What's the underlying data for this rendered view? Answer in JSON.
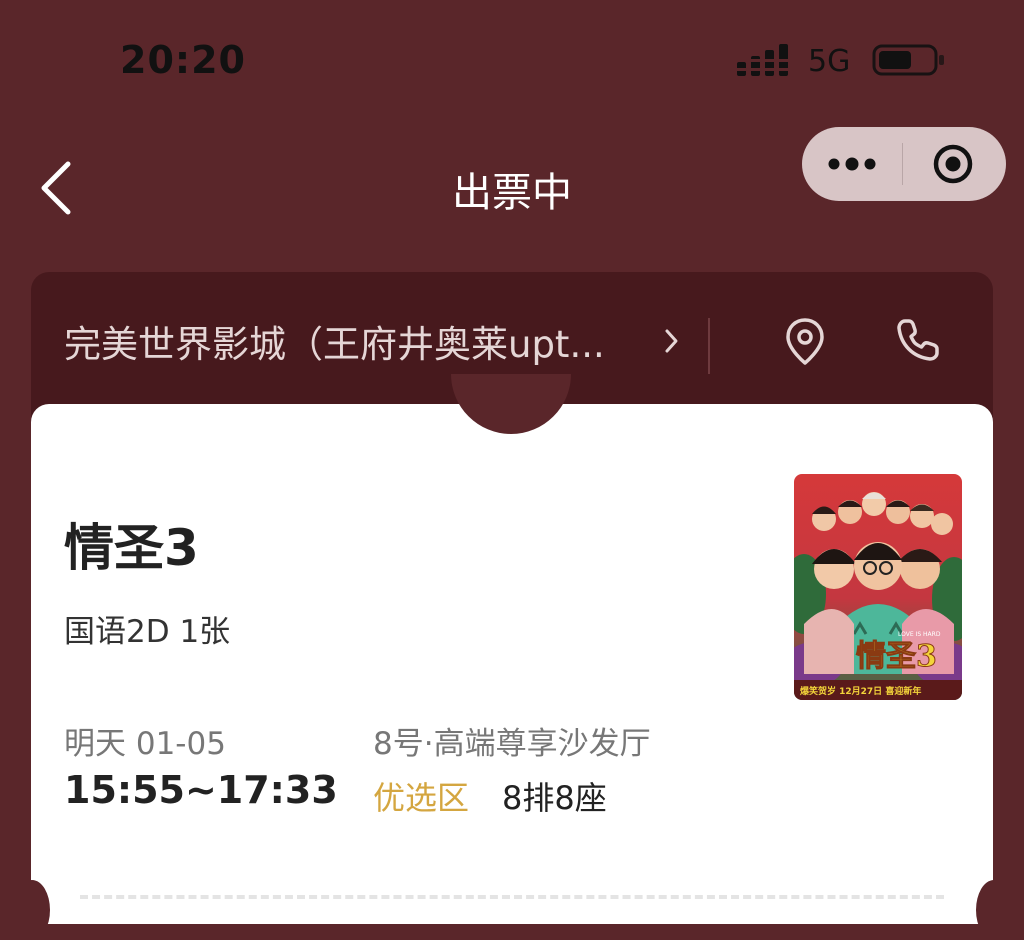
{
  "status_bar": {
    "time": "20:20",
    "network": "5G"
  },
  "nav": {
    "title": "出票中"
  },
  "cinema": {
    "name": "完美世界影城（王府井奥莱upt..."
  },
  "movie": {
    "title": "情圣3",
    "format": "国语2D 1张",
    "date": "明天 01-05",
    "time_range": "15:55~17:33",
    "hall": "8号·高端尊享沙发厅",
    "zone": "优选区",
    "seat": "8排8座",
    "poster": {
      "title_text": "情圣3",
      "release_text": "爆笑贺岁 12月27日 喜迎新年",
      "tagline": "LOVE IS HARD"
    }
  },
  "colors": {
    "background": "#5a262a",
    "cinema_bar": "#47191d",
    "zone_accent": "#d4a640"
  },
  "icons": [
    "signal-icon",
    "battery-icon",
    "back-icon",
    "more-icon",
    "close-target-icon",
    "location-icon",
    "phone-icon",
    "chevron-right-icon"
  ]
}
